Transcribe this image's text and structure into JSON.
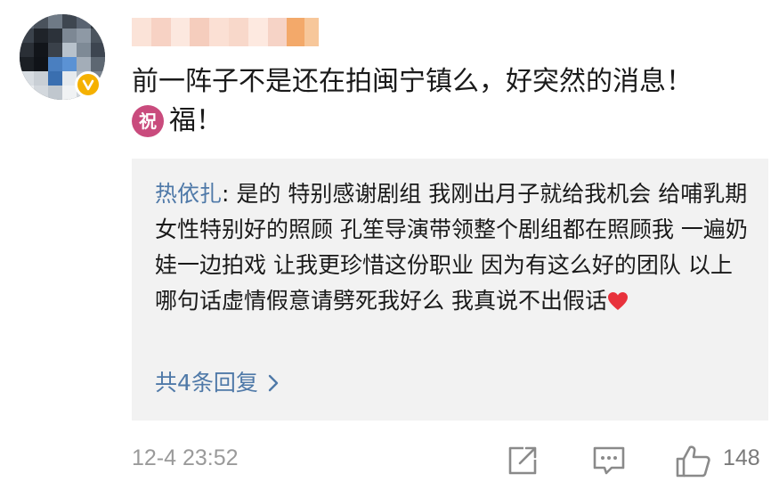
{
  "comment": {
    "avatar_icon": "avatar-blurred",
    "verified_badge_icon": "verified-v-icon",
    "username_hidden": "pixelated",
    "text_line1": "前一阵子不是还在拍闽宁镇么，好突然的消息！",
    "blessing_badge": "祝",
    "text_line2_rest": "福！"
  },
  "reply_box": {
    "author": "热依扎",
    "separator": ": ",
    "text": "是的 特别感谢剧组 我刚出月子就给我机会 给哺乳期女性特别好的照顾 孔笙导演带领整个剧组都在照顾我 一遍奶娃一边拍戏 让我更珍惜这份职业 因为有这么好的团队 以上哪句话虚情假意请劈死我好么 我真说不出假话",
    "heart_icon": "red-heart-icon",
    "more_replies_label": "共4条回复",
    "chevron_icon": "chevron-right-icon"
  },
  "footer": {
    "timestamp": "12-4 23:52",
    "share_icon": "share-icon",
    "comment_icon": "comment-icon",
    "like_icon": "thumbs-up-icon",
    "like_count": "148"
  },
  "colors": {
    "link_blue": "#4f79a8",
    "reply_bg": "#f2f2f2",
    "meta_gray": "#9a9a9a",
    "badge_gold": "#f5b100",
    "blessing_pink": "#c94b7d",
    "heart_red": "#e8323c"
  }
}
